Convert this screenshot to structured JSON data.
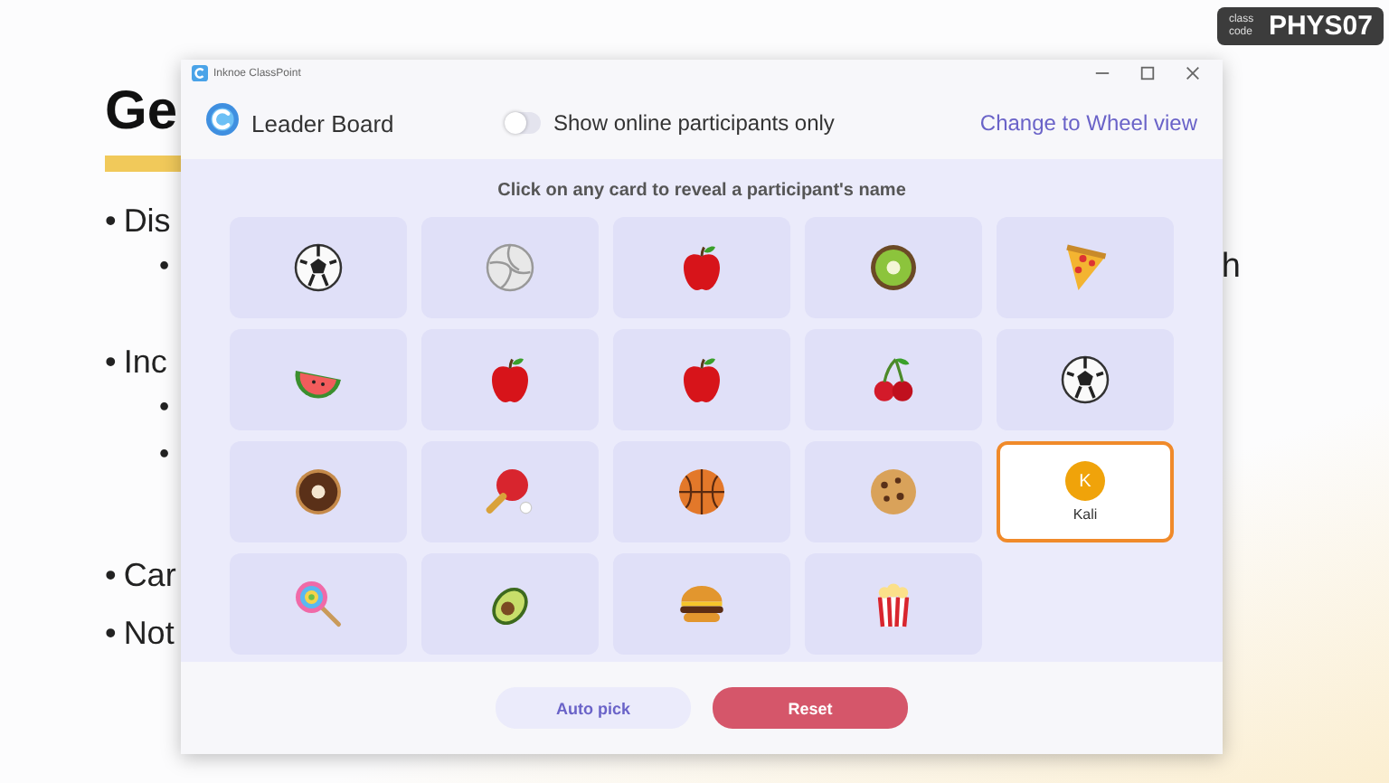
{
  "slide": {
    "title": "Ge",
    "bullets": [
      {
        "bullet": "•",
        "text": "Dis",
        "children": [
          {
            "bullet": "•",
            "tail": "h"
          }
        ]
      },
      {
        "bullet": "•",
        "text": "Inc",
        "children": [
          {
            "bullet": "•"
          },
          {
            "bullet": "•"
          }
        ]
      },
      {
        "bullet": "•",
        "text": "Car"
      },
      {
        "bullet": "•",
        "text": "Not"
      }
    ]
  },
  "class_code": {
    "label": "class code",
    "code": "PHYS07"
  },
  "window": {
    "title": "Inknoe ClassPoint"
  },
  "header": {
    "title": "Leader Board",
    "toggle": {
      "label": "Show online participants only",
      "on": false
    },
    "link": "Change to Wheel view"
  },
  "instruction": "Click on any card to reveal a participant's name",
  "cards": [
    {
      "kind": "soccer"
    },
    {
      "kind": "volleyball"
    },
    {
      "kind": "apple"
    },
    {
      "kind": "kiwi"
    },
    {
      "kind": "pizza"
    },
    {
      "kind": "watermelon"
    },
    {
      "kind": "apple"
    },
    {
      "kind": "apple"
    },
    {
      "kind": "cherry"
    },
    {
      "kind": "soccer"
    },
    {
      "kind": "donut"
    },
    {
      "kind": "pingpong"
    },
    {
      "kind": "basketball"
    },
    {
      "kind": "cookie"
    },
    {
      "kind": "revealed",
      "initial": "K",
      "name": "Kali"
    },
    {
      "kind": "lollipop"
    },
    {
      "kind": "avocado"
    },
    {
      "kind": "burger"
    },
    {
      "kind": "popcorn"
    }
  ],
  "buttons": [
    {
      "kind": "secondary",
      "label": "Auto pick"
    },
    {
      "kind": "primary",
      "label": "Reset"
    }
  ]
}
